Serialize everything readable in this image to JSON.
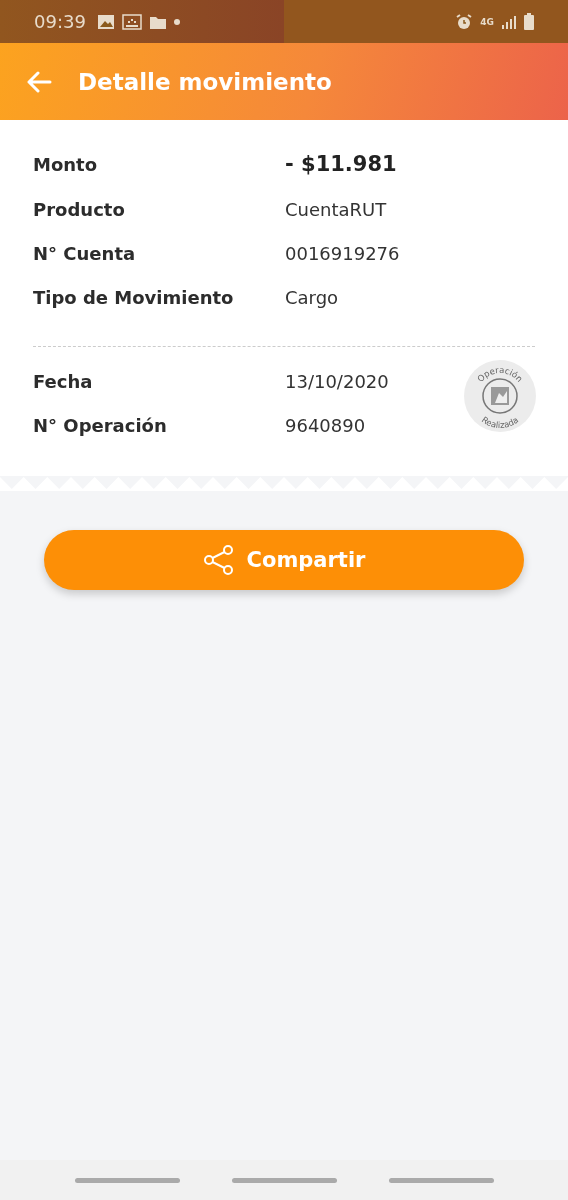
{
  "status_bar": {
    "time": "09:39",
    "network": "4G"
  },
  "header": {
    "title": "Detalle movimiento"
  },
  "details": [
    {
      "label": "Monto",
      "value": "- $11.981",
      "kind": "amount"
    },
    {
      "label": "Producto",
      "value": "CuentaRUT",
      "kind": "plain"
    },
    {
      "label": "N° Cuenta",
      "value": "0016919276",
      "kind": "plain"
    },
    {
      "label": "Tipo de Movimiento",
      "value": "Cargo",
      "kind": "plain"
    }
  ],
  "operation": [
    {
      "label": "Fecha",
      "value": "13/10/2020"
    },
    {
      "label": "N° Operación",
      "value": "9640890"
    }
  ],
  "stamp": {
    "top": "Operación",
    "bottom": "Realizada"
  },
  "share_button": {
    "label": "Compartir"
  }
}
